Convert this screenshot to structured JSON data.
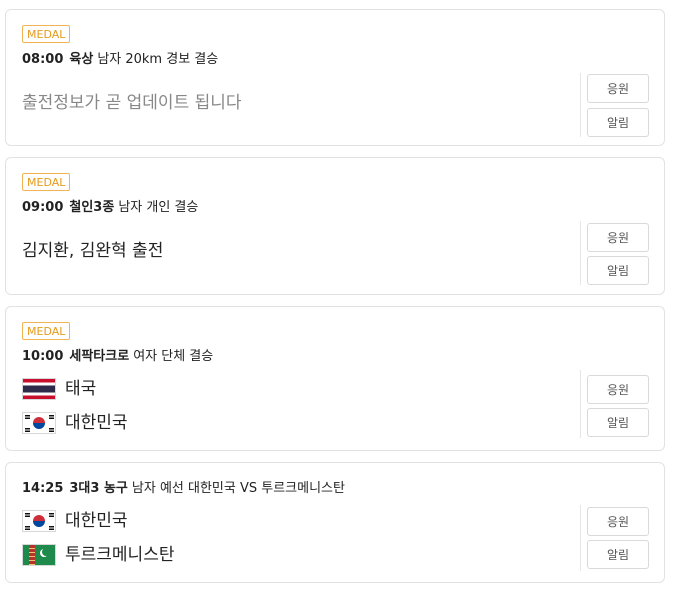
{
  "buttons": {
    "cheer": "응원",
    "alarm": "알림"
  },
  "colors": {
    "medal_badge": "#e59a1c",
    "border": "#e2e2e2",
    "muted_text": "#888888"
  },
  "events": [
    {
      "badge": "MEDAL",
      "time": "08:00",
      "sport": "육상",
      "detail": "남자 20km 경보 결승",
      "info": "출전정보가 곧 업데이트 됩니다"
    },
    {
      "badge": "MEDAL",
      "time": "09:00",
      "sport": "철인3종",
      "detail": "남자 개인 결승",
      "info": "김지환, 김완혁 출전"
    },
    {
      "badge": "MEDAL",
      "time": "10:00",
      "sport": "세팍타크로",
      "detail": "여자 단체 결승",
      "teams": [
        {
          "name": "태국",
          "flag": "thailand-flag-icon"
        },
        {
          "name": "대한민국",
          "flag": "south-korea-flag-icon"
        }
      ]
    },
    {
      "time": "14:25",
      "sport": "3대3 농구",
      "detail": "남자 예선 대한민국 VS 투르크메니스탄",
      "teams": [
        {
          "name": "대한민국",
          "flag": "south-korea-flag-icon"
        },
        {
          "name": "투르크메니스탄",
          "flag": "turkmenistan-flag-icon"
        }
      ]
    }
  ]
}
